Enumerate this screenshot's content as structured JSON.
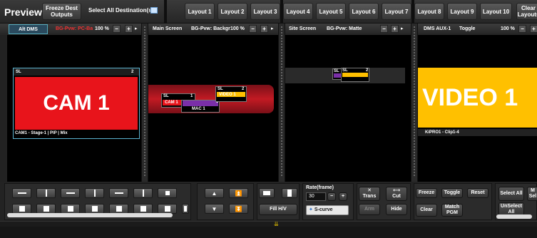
{
  "toolbar": {
    "title": "Preview",
    "freeze_dest": "Freeze Dest Outputs",
    "select_all_dest": "Select All Destination(s)",
    "layouts": [
      "Layout 1",
      "Layout 2",
      "Layout 3",
      "Layout 4",
      "Layout 5",
      "Layout 6",
      "Layout 7",
      "Layout 8",
      "Layout 9",
      "Layout 10"
    ],
    "clear_layouts": "Clear Layouts"
  },
  "panels": [
    {
      "tab": "Alt DMS",
      "bg": "BG-Pvw: PC-Ba",
      "zoom": "100 %",
      "layer": {
        "text": "CAM 1",
        "sl": "SL",
        "num": "2",
        "source": "CAM1 - Stage-1 | PIP | Mix",
        "color": "#e8141b"
      }
    },
    {
      "tab": "Main Screen",
      "bg": "BG-Pvw: Backgr",
      "zoom": "100 %",
      "layers": [
        {
          "sl": "SL",
          "num": "1",
          "label": "CAM 1",
          "color": "#e8141b"
        },
        {
          "sl": "",
          "num": "3",
          "label": "MAC 1",
          "color": "#7a2fa8"
        },
        {
          "sl": "SL",
          "num": "2",
          "label": "VIDEO 1",
          "color": "#ffc000"
        }
      ]
    },
    {
      "tab": "Site Screen",
      "bg": "BG-Pvw: Matte",
      "zoom": "100 %",
      "layers": [
        {
          "sl": "SL",
          "num": "1",
          "color": "#7a2fa8"
        },
        {
          "sl": "SL",
          "num": "2",
          "color": "#ffc000"
        }
      ]
    },
    {
      "tab": "DMS AUX-1",
      "bg": "Toggle",
      "zoom": "100 %",
      "layer": {
        "text": "VIDEO 1",
        "source": "KiPRO1 - Clip1-4",
        "color": "#ffc000"
      }
    }
  ],
  "controls": {
    "fill": "Fill H/V",
    "rate_label": "Rate(frame)",
    "rate_value": "30",
    "curve": "S-curve",
    "trans": "Trans",
    "cut": "Cut",
    "arm": "Arm",
    "hide": "Hide",
    "freeze": "Freeze",
    "toggle": "Toggle",
    "reset": "Reset",
    "clear": "Clear",
    "match_pgm": "Match PGM",
    "select_all": "Select All",
    "unselect_all": "UnSelect All",
    "more": "M Sel"
  }
}
